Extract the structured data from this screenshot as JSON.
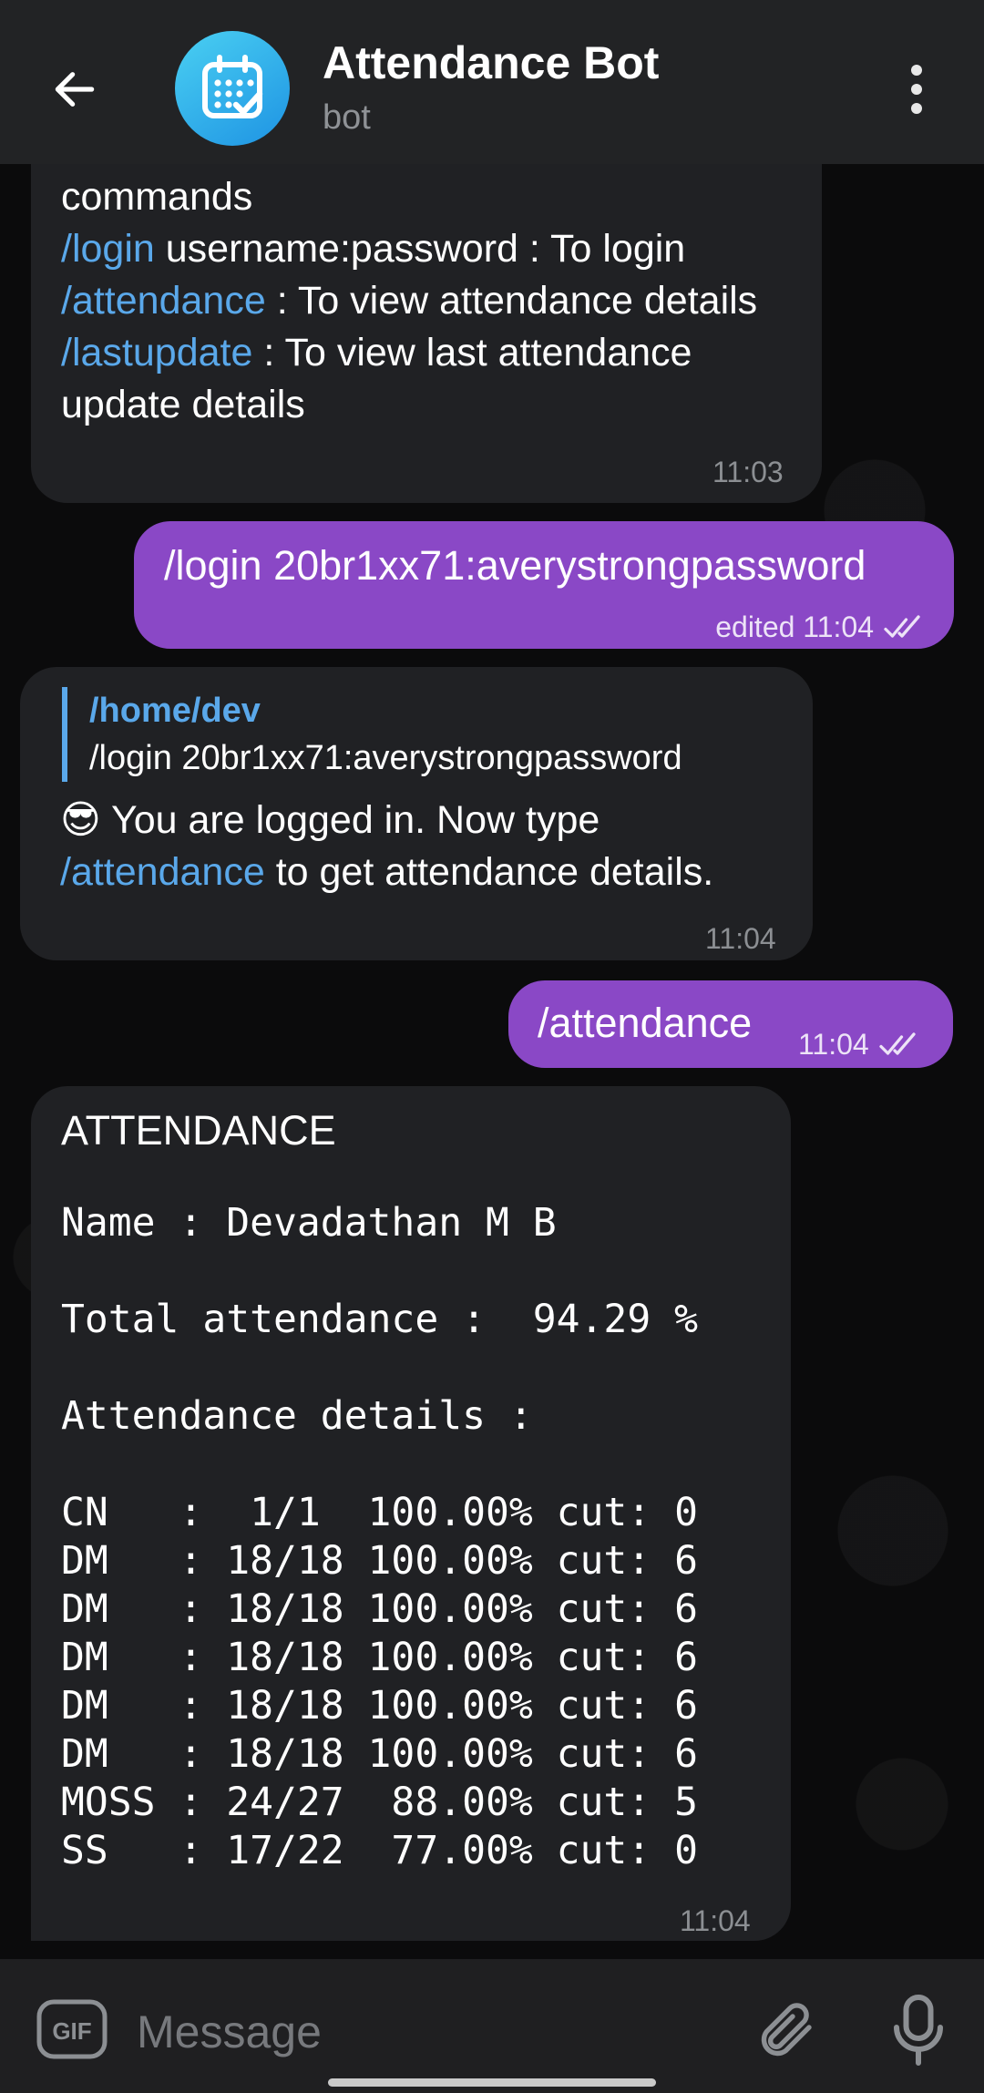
{
  "header": {
    "title": "Attendance Bot",
    "subtitle": "bot"
  },
  "messages": {
    "m1": {
      "line1": "commands",
      "line2_cmd": "/login",
      "line2_text": " username:password : To login",
      "line3_cmd": "/attendance",
      "line3_text": " : To view attendance details",
      "line4_cmd": "/lastupdate",
      "line4_text": " : To view last attendance update details",
      "time": "11:03"
    },
    "m2": {
      "text": "/login 20br1xx71:averystrongpassword",
      "status": "edited 11:04"
    },
    "m3": {
      "reply_name": "/home/dev",
      "reply_text": "/login 20br1xx71:averystrongpassword",
      "emoji": "😎",
      "text_before": " You are logged in. Now type ",
      "cmd": "/attendance",
      "text_after": " to get attendance details.",
      "time": "11:04"
    },
    "m4": {
      "text": "/attendance",
      "time": "11:04"
    },
    "m5": {
      "heading": "ATTENDANCE",
      "name_line": "Name : Devadathan M B",
      "total_line": "Total attendance :  94.29 %",
      "details_label": "Attendance details :",
      "rows": [
        "CN   :  1/1  100.00% cut: 0",
        "DM   : 18/18 100.00% cut: 6",
        "DM   : 18/18 100.00% cut: 6",
        "DM   : 18/18 100.00% cut: 6",
        "DM   : 18/18 100.00% cut: 6",
        "DM   : 18/18 100.00% cut: 6",
        "MOSS : 24/27  88.00% cut: 5",
        "SS   : 17/22  77.00% cut: 0"
      ],
      "time": "11:04"
    }
  },
  "input": {
    "placeholder": "Message",
    "gif_label": "GIF"
  },
  "colors": {
    "accent_link": "#5aa8ea",
    "outgoing_bubble": "#8a48c6",
    "incoming_bubble": "#202124",
    "header_bg": "#222325"
  },
  "icons": [
    "back-arrow-icon",
    "calendar-check-icon",
    "more-vertical-icon",
    "double-check-icon",
    "gif-icon",
    "paperclip-icon",
    "microphone-icon"
  ]
}
